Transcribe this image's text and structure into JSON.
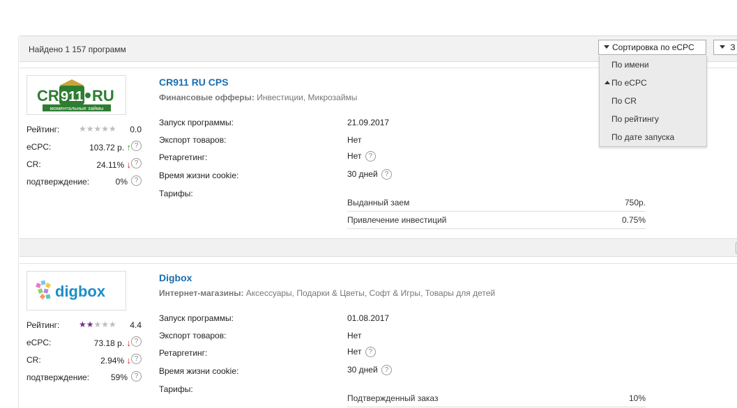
{
  "header": {
    "found_text": "Найдено 1 157 программ",
    "sort_label": "Сортировка по eCPC",
    "second_label": "З"
  },
  "sort_menu": [
    {
      "label": "По имени"
    },
    {
      "label": "По eCPC",
      "active": true
    },
    {
      "label": "По CR"
    },
    {
      "label": "По рейтингу"
    },
    {
      "label": "По дате запуска"
    }
  ],
  "programs": [
    {
      "title": "CR911 RU CPS",
      "category_label": "Финансовые офферы:",
      "category_values": "Инвестиции, Микрозаймы",
      "logo": {
        "text_main": "CR911",
        "text_tail": "RU",
        "tagline": "моментальные займы"
      },
      "stats": {
        "rating_label": "Рейтинг:",
        "rating_stars": "★★★★★",
        "rating_value": "0.0",
        "rating_filled": 0,
        "ecpc_label": "eCPC:",
        "ecpc_value": "103.72 р.",
        "ecpc_arrow": "↑",
        "cr_label": "CR:",
        "cr_value": "24.11%",
        "cr_arrow": "↓",
        "confirm_label": "подтверждение:",
        "confirm_value": "0%"
      },
      "info": {
        "launch_label": "Запуск программы:",
        "launch_value": "21.09.2017",
        "export_label": "Экспорт товаров:",
        "export_value": "Нет",
        "retarget_label": "Ретаргетинг:",
        "retarget_value": "Нет",
        "cookie_label": "Время жизни cookie:",
        "cookie_value": "30 дней",
        "tariffs_label": "Тарифы:"
      },
      "tariffs": [
        {
          "name": "Выданный заем",
          "value": "750р."
        },
        {
          "name": "Привлечение инвестиций",
          "value": "0.75%"
        }
      ]
    },
    {
      "title": "Digbox",
      "category_label": "Интернет-магазины:",
      "category_values": "Аксессуары, Подарки & Цветы, Софт & Игры, Товары для детей",
      "logo": {
        "text_main": "digbox"
      },
      "stats": {
        "rating_label": "Рейтинг:",
        "rating_stars": "★★★★★",
        "rating_value": "4.4",
        "rating_filled": 2,
        "ecpc_label": "eCPC:",
        "ecpc_value": "73.18 р.",
        "ecpc_arrow": "↓",
        "cr_label": "CR:",
        "cr_value": "2.94%",
        "cr_arrow": "↓",
        "confirm_label": "подтверждение:",
        "confirm_value": "59%"
      },
      "info": {
        "launch_label": "Запуск программы:",
        "launch_value": "01.08.2017",
        "export_label": "Экспорт товаров:",
        "export_value": "Нет",
        "retarget_label": "Ретаргетинг:",
        "retarget_value": "Нет",
        "cookie_label": "Время жизни cookie:",
        "cookie_value": "30 дней",
        "tariffs_label": "Тарифы:"
      },
      "tariffs": [
        {
          "name": "Подтвержденный заказ",
          "value": "10%"
        }
      ]
    }
  ],
  "qmark_glyph": "?",
  "colors": {
    "link": "#1a6eaf",
    "arrow_up": "#2a9a2a",
    "arrow_down": "#d01818",
    "star_on": "#7b2a8d",
    "star_off": "#bdbdbd"
  }
}
